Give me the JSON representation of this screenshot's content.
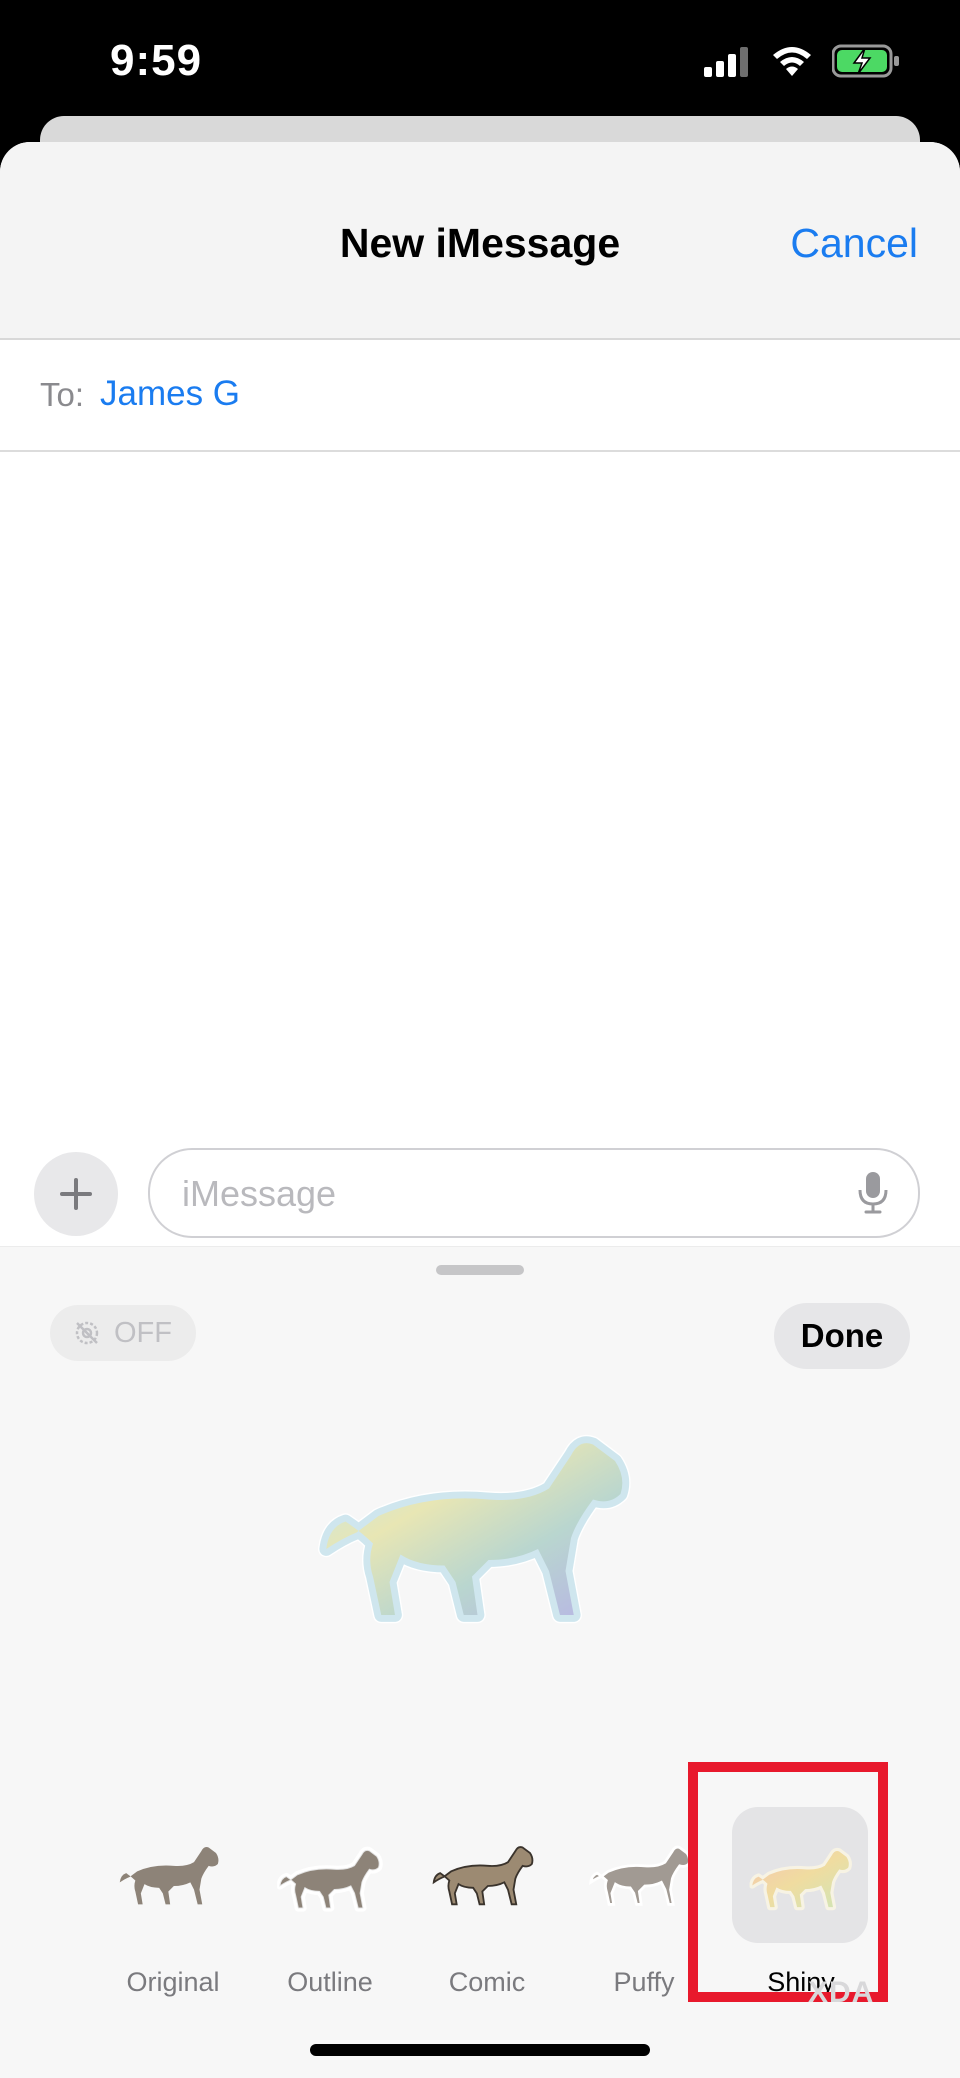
{
  "status_bar": {
    "time": "9:59"
  },
  "header": {
    "title": "New iMessage",
    "cancel_label": "Cancel"
  },
  "recipient": {
    "label": "To:",
    "name": "James G"
  },
  "composer": {
    "placeholder": "iMessage"
  },
  "sticker_panel": {
    "toggle_label": "OFF",
    "done_label": "Done",
    "styles": [
      {
        "label": "Original",
        "selected": false
      },
      {
        "label": "Outline",
        "selected": false
      },
      {
        "label": "Comic",
        "selected": false
      },
      {
        "label": "Puffy",
        "selected": false
      },
      {
        "label": "Shiny",
        "selected": true
      }
    ]
  },
  "watermark": "XDA",
  "colors": {
    "accent": "#1a7cf0",
    "highlight": "#e8192c",
    "battery": "#4cd964"
  }
}
